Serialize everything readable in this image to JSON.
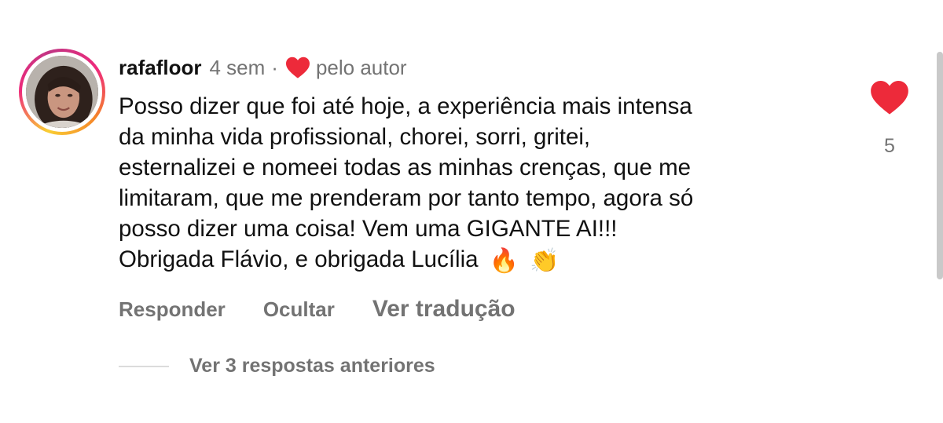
{
  "comment": {
    "username": "rafafloor",
    "time": "4 sem",
    "separator": "·",
    "liked_by_author_label": "pelo autor",
    "body_lines": [
      "Posso dizer que foi até hoje, a experiência mais intensa",
      "da minha vida profissional, chorei, sorri, gritei,",
      "esternalizei e nomeei todas as minhas crenças, que me",
      "limitaram, que me prenderam por tanto tempo, agora só",
      "posso dizer uma coisa! Vem uma GIGANTE AI!!!",
      "Obrigada Flávio, e obrigada Lucília"
    ],
    "emojis": [
      "🔥",
      "👏"
    ],
    "like_count": "5"
  },
  "actions": {
    "reply": "Responder",
    "hide": "Ocultar",
    "translate": "Ver tradução"
  },
  "replies": {
    "label": "Ver 3 respostas anteriores"
  },
  "colors": {
    "heart": "#ed2a3a",
    "secondary_text": "#737373"
  },
  "icons": {
    "author_like": "heart-icon",
    "like_button": "heart-icon"
  }
}
